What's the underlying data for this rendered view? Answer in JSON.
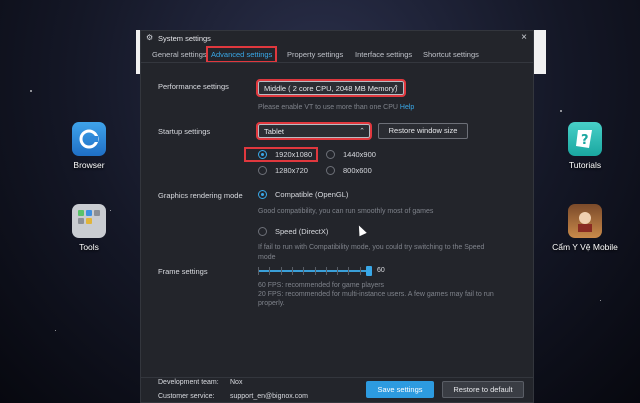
{
  "dialog": {
    "title": "System settings",
    "close_glyph": "×"
  },
  "tabs": [
    {
      "label": "General settings"
    },
    {
      "label": "Advanced settings",
      "active": true
    },
    {
      "label": "Property settings"
    },
    {
      "label": "Interface settings"
    },
    {
      "label": "Shortcut settings"
    }
  ],
  "performance": {
    "label": "Performance settings",
    "value": "Middle ( 2 core CPU, 2048 MB Memory)",
    "hint": "Please enable VT to use more than one CPU",
    "hint_link": "Help"
  },
  "startup": {
    "label": "Startup settings",
    "value": "Tablet",
    "restore_button": "Restore window size",
    "resolutions": [
      {
        "label": "1920x1080",
        "selected": true
      },
      {
        "label": "1440x900",
        "selected": false
      },
      {
        "label": "1280x720",
        "selected": false
      },
      {
        "label": "800x600",
        "selected": false
      }
    ]
  },
  "graphics": {
    "label": "Graphics rendering mode",
    "opt1": "Compatible (OpenGL)",
    "opt1_desc": "Good compatibility, you can run smoothly most of games",
    "opt2": "Speed (DirectX)",
    "opt2_desc_line1": " If fail to run with Compatibility mode, you could try switching to the Speed",
    "opt2_desc_line2": "mode"
  },
  "frame": {
    "label": "Frame settings",
    "value": "60",
    "value_fraction": 0.98,
    "note1": "60 FPS: recommended for game players",
    "note2_line1": "20 FPS: recommended for multi-instance users. A few games may fail to run",
    "note2_line2": "properly."
  },
  "footer": {
    "dev_team_label": "Development team:",
    "dev_team_value": "Nox",
    "service_label": "Customer service:",
    "service_value": "support_en@bignox.com",
    "save_button": "Save settings",
    "restore_default_button": "Restore to default"
  },
  "desktop": {
    "browser_label": "Browser",
    "tools_label": "Tools",
    "tutorials_label": "Tutorials",
    "game_label": "Cẩm Y Vệ Mobile"
  },
  "colors": {
    "accent": "#2d9be0",
    "highlight": "#e0383e",
    "dialog_bg": "#23252b"
  }
}
